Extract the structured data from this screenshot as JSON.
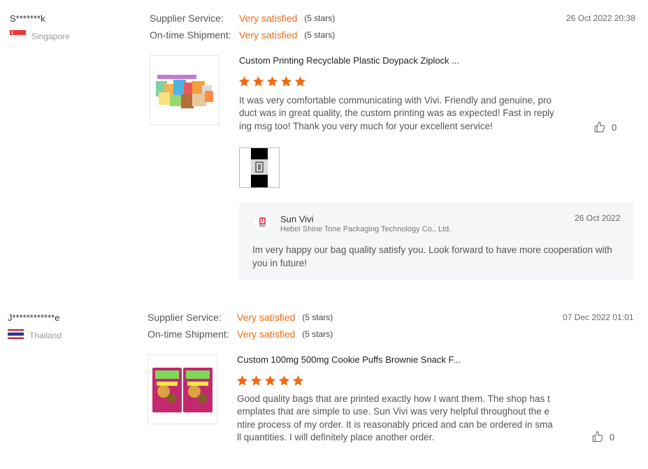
{
  "rating_labels": {
    "supplier_service": "Supplier Service:",
    "on_time_shipment": "On-time Shipment:"
  },
  "colors": {
    "accent": "#f26a10",
    "reply_background": "#f5f6f8"
  },
  "reviews": [
    {
      "reviewer": "S*******k",
      "country": "Singapore",
      "flag_icon": "singapore-flag-icon",
      "supplier_service": "Very satisfied",
      "supplier_service_stars": "(5 stars)",
      "on_time_shipment": "Very satisfied",
      "on_time_shipment_stars": "(5 stars)",
      "timestamp": "26 Oct 2022 20:38",
      "product_title": "Custom Printing Recyclable Plastic Doypack Ziplock ...",
      "rating": 5,
      "body": "It was very comfortable communicating with Vivi. Friendly and genuine, product was in great quality, the custom printing was as expected! Fast in replying msg too! Thank you very much for your excellent service!",
      "likes": "0",
      "reply": {
        "logo_text": "Vivi",
        "name": "Sun Vivi",
        "company": "Hebei Shine Tone Packaging Technology Co., Ltd.",
        "date": "26 Oct 2022",
        "body": "Im very happy our bag quality satisfy you. Look forward to have more cooperation with you in future!"
      }
    },
    {
      "reviewer": "J************e",
      "country": "Thailand",
      "flag_icon": "thailand-flag-icon",
      "supplier_service": "Very satisfied",
      "supplier_service_stars": "(5 stars)",
      "on_time_shipment": "Very satisfied",
      "on_time_shipment_stars": "(5 stars)",
      "timestamp": "07 Dec 2022 01:01",
      "product_title": "Custom 100mg 500mg Cookie Puffs Brownie Snack F...",
      "rating": 5,
      "body": "Good quality bags that are printed exactly how I want them. The shop has templates that are simple to use. Sun Vivi was very helpful throughout the entire process of my order. It is reasonably priced and can be ordered in small quantities. I will definitely place another order.",
      "likes": "0"
    }
  ]
}
